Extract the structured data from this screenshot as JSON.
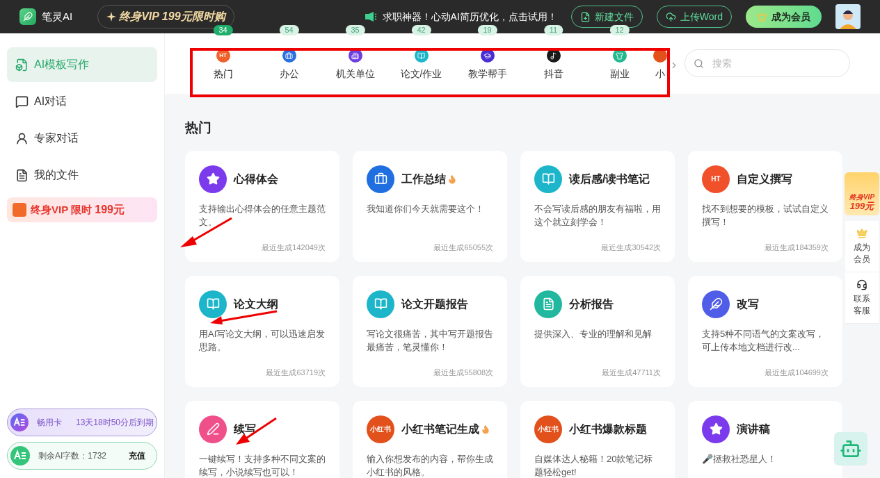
{
  "header": {
    "brand": "笔灵AI",
    "promo": "终身VIP 199元限时购",
    "notice": "求职神器！心动AI简历优化，点击试用！",
    "buttons": [
      {
        "label": "新建文件",
        "kind": "new"
      },
      {
        "label": "上传Word",
        "kind": "upload"
      },
      {
        "label": "成为会员",
        "kind": "vip"
      }
    ]
  },
  "sidebar": {
    "items": [
      {
        "label": "AI模板写作",
        "selected": true
      },
      {
        "label": "AI对话",
        "selected": false
      },
      {
        "label": "专家对话",
        "selected": false
      },
      {
        "label": "我的文件",
        "selected": false
      }
    ],
    "promo": {
      "text": "终身VIP 限时 ",
      "price": "199元"
    },
    "card": {
      "name": "畅用卡",
      "expiry": "13天18时50分后到期"
    },
    "words": {
      "label": "剩余AI字数：1732",
      "action": "充值"
    }
  },
  "tabs": [
    {
      "label": "热门",
      "count": "34",
      "selected": true,
      "color": "#f0602a",
      "icon_text": "HT"
    },
    {
      "label": "办公",
      "count": "54",
      "selected": false,
      "color": "#2b6fe0"
    },
    {
      "label": "机关单位",
      "count": "35",
      "selected": false,
      "color": "#6d3fe0"
    },
    {
      "label": "论文/作业",
      "count": "42",
      "selected": false,
      "color": "#1cb5c9"
    },
    {
      "label": "教学帮手",
      "count": "19",
      "selected": false,
      "color": "#4a2fd6"
    },
    {
      "label": "抖音",
      "count": "11",
      "selected": false,
      "color": "#1a1a1a"
    },
    {
      "label": "副业",
      "count": "12",
      "selected": false,
      "color": "#22b890"
    },
    {
      "label": "小",
      "selected": false,
      "color": "#e2511c"
    }
  ],
  "search": {
    "placeholder": "搜索"
  },
  "section_title": "热门",
  "cards": [
    {
      "title": "心得体会",
      "hot": false,
      "desc": "支持输出心得体会的任意主题范文。",
      "stat": "最近生成142049次",
      "color": "#7c3aed"
    },
    {
      "title": "工作总结",
      "hot": true,
      "desc": "我知道你们今天就需要这个！",
      "stat": "最近生成65055次",
      "color": "#1f6fe0"
    },
    {
      "title": "读后感/读书笔记",
      "hot": false,
      "desc": "不会写读后感的朋友有福啦，用这个就立刻学会！",
      "stat": "最近生成30542次",
      "color": "#1cb5c9"
    },
    {
      "title": "自定义撰写",
      "hot": false,
      "desc": "找不到想要的模板，试试自定义撰写！",
      "stat": "最近生成184359次",
      "color": "#f0502a",
      "icon_text": "HT"
    },
    {
      "title": "论文大纲",
      "hot": false,
      "desc": "用AI写论文大纲，可以迅速启发思路。",
      "stat": "最近生成63719次",
      "color": "#1cb5c9"
    },
    {
      "title": "论文开题报告",
      "hot": false,
      "desc": "写论文很痛苦，其中写开题报告最痛苦，笔灵懂你！",
      "stat": "最近生成55808次",
      "color": "#1cb5c9"
    },
    {
      "title": "分析报告",
      "hot": false,
      "desc": "提供深入、专业的理解和见解",
      "stat": "最近生成47711次",
      "color": "#22b8a0"
    },
    {
      "title": "改写",
      "hot": false,
      "desc": "支持5种不同语气的文案改写，可上传本地文档进行改...",
      "stat": "最近生成104699次",
      "color": "#4f5de8"
    },
    {
      "title": "续写",
      "hot": false,
      "desc": "一键续写！支持多种不同文案的续写，小说续写也可以！",
      "color": "#f0508a"
    },
    {
      "title": "小红书笔记生成",
      "hot": true,
      "desc": "输入你想发布的内容，帮你生成小红书的风格。",
      "color": "#e2511c",
      "icon_text": "小红书"
    },
    {
      "title": "小红书爆款标题",
      "hot": false,
      "desc": "自媒体达人秘籍！20款笔记标题轻松get!",
      "color": "#e2511c",
      "icon_text": "小红书"
    },
    {
      "title": "演讲稿",
      "hot": false,
      "desc": "🎤拯救社恐星人！",
      "color": "#7c3aed"
    }
  ],
  "floating": {
    "vip_line1": "终身VIP",
    "vip_line2": "199元",
    "items": [
      {
        "label": "成为会员",
        "kind": "crown"
      },
      {
        "label": "联系客服",
        "kind": "support"
      }
    ]
  }
}
